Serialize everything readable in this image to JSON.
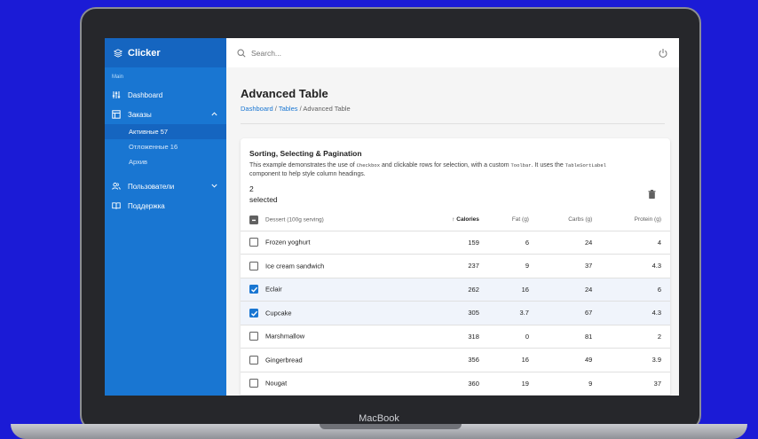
{
  "device": {
    "brand_label": "MacBook"
  },
  "sidebar": {
    "logo": "Clicker",
    "section_label": "Main",
    "items": [
      {
        "label": "Dashboard",
        "icon": "sliders-icon"
      },
      {
        "label": "Заказы",
        "icon": "table-icon",
        "expanded": true
      },
      {
        "label": "Пользователи",
        "icon": "users-icon",
        "expanded": false
      },
      {
        "label": "Поддержка",
        "icon": "book-icon"
      }
    ],
    "orders_sub": [
      {
        "label": "Активные 57",
        "active": true
      },
      {
        "label": "Отложенные 16",
        "active": false
      },
      {
        "label": "Архив",
        "active": false
      }
    ]
  },
  "topbar": {
    "search_placeholder": "Search..."
  },
  "page": {
    "title": "Advanced Table",
    "breadcrumb": [
      "Dashboard",
      "Tables",
      "Advanced Table"
    ],
    "separator": "/"
  },
  "card": {
    "title": "Sorting, Selecting & Pagination",
    "desc_1": "This example demonstrates the use of ",
    "desc_code_1": "Checkbox",
    "desc_2": " and clickable rows for selection, with a custom ",
    "desc_code_2": "Toolbar",
    "desc_3": ". It uses the ",
    "desc_code_3": "TableSortLabel",
    "desc_4": "component to help style column headings.",
    "selected_count": "2",
    "selected_label": "selected"
  },
  "table": {
    "headers": [
      "Dessert (100g serving)",
      "Calories",
      "Fat (g)",
      "Carbs (g)",
      "Protein (g)"
    ],
    "sort_arrow": "↑",
    "rows": [
      {
        "name": "Frozen yoghurt",
        "calories": "159",
        "fat": "6",
        "carbs": "24",
        "protein": "4",
        "selected": false
      },
      {
        "name": "Ice cream sandwich",
        "calories": "237",
        "fat": "9",
        "carbs": "37",
        "protein": "4.3",
        "selected": false
      },
      {
        "name": "Eclair",
        "calories": "262",
        "fat": "16",
        "carbs": "24",
        "protein": "6",
        "selected": true
      },
      {
        "name": "Cupcake",
        "calories": "305",
        "fat": "3.7",
        "carbs": "67",
        "protein": "4.3",
        "selected": true
      },
      {
        "name": "Marshmallow",
        "calories": "318",
        "fat": "0",
        "carbs": "81",
        "protein": "2",
        "selected": false
      },
      {
        "name": "Gingerbread",
        "calories": "356",
        "fat": "16",
        "carbs": "49",
        "protein": "3.9",
        "selected": false
      },
      {
        "name": "Nougat",
        "calories": "360",
        "fat": "19",
        "carbs": "9",
        "protein": "37",
        "selected": false
      }
    ]
  },
  "colors": {
    "background": "#1b1bd6",
    "sidebar": "#1976d2",
    "sidebar_header": "#1565c0",
    "accent": "#1976d2"
  }
}
